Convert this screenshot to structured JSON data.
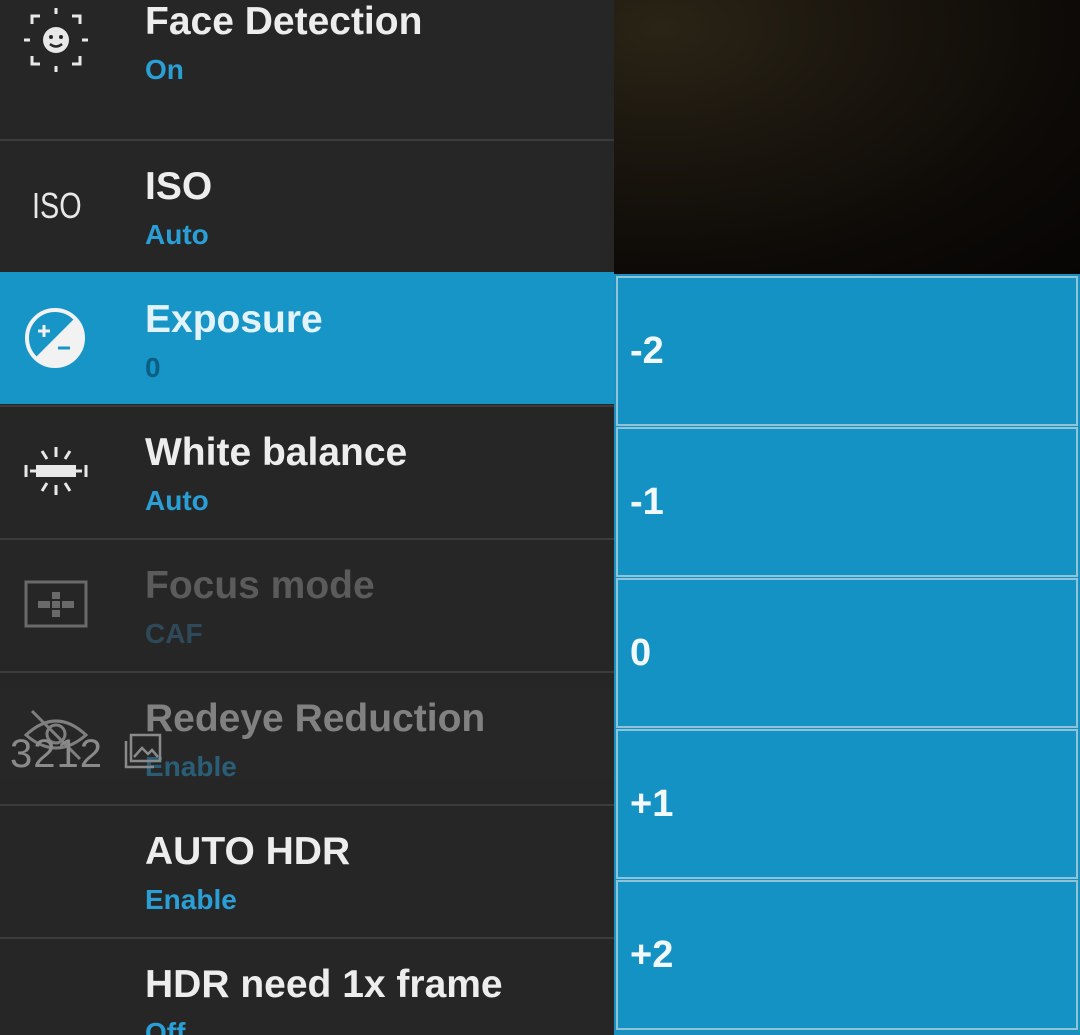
{
  "settings": {
    "items": [
      {
        "title": "Face Detection",
        "value": "On",
        "icon": "face-detection-icon"
      },
      {
        "title": "ISO",
        "value": "Auto",
        "icon": "iso-icon",
        "icon_text": "ISO"
      },
      {
        "title": "Exposure",
        "value": "0",
        "icon": "exposure-icon"
      },
      {
        "title": "White balance",
        "value": "Auto",
        "icon": "white-balance-icon"
      },
      {
        "title": "Focus mode",
        "value": "CAF",
        "icon": "focus-mode-icon"
      },
      {
        "title": "Redeye Reduction",
        "value": "Enable",
        "icon": "redeye-icon"
      },
      {
        "title": "AUTO HDR",
        "value": "Enable"
      },
      {
        "title": "HDR need 1x frame",
        "value": "Off"
      }
    ]
  },
  "overlay": {
    "photo_count": "3212"
  },
  "exposure_options": [
    "-2",
    "-1",
    "0",
    "+1",
    "+2"
  ],
  "colors": {
    "accent": "#1695c6",
    "value_text": "#2a9fd6",
    "menu_bg": "#262626"
  }
}
